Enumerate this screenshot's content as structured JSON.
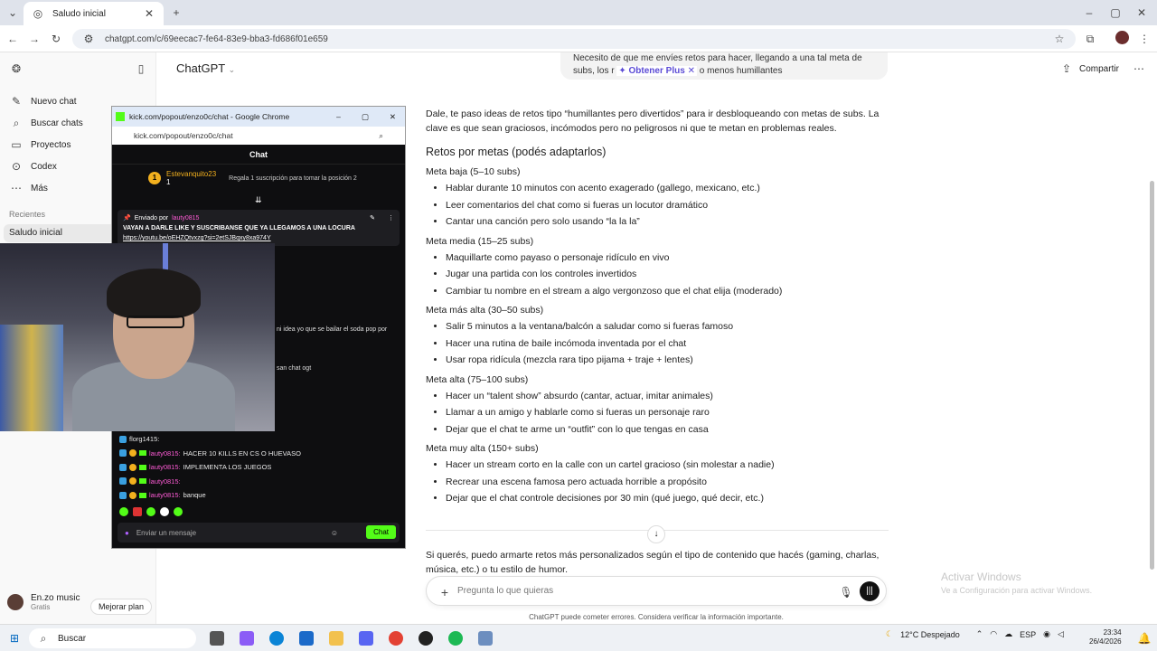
{
  "browser": {
    "tab_title": "Saludo inicial",
    "url": "chatgpt.com/c/69eecac7-fe64-83e9-bba3-fd686f01e659"
  },
  "sidebar": {
    "items": [
      {
        "label": "Nuevo chat"
      },
      {
        "label": "Buscar chats"
      },
      {
        "label": "Proyectos"
      },
      {
        "label": "Codex"
      },
      {
        "label": "Más"
      }
    ],
    "recent_title": "Recientes",
    "recent_active": "Saludo inicial",
    "user_name": "En.zo music",
    "user_plan": "Gratis",
    "upgrade_label": "Mejorar plan"
  },
  "header": {
    "title": "ChatGPT",
    "share": "Compartir"
  },
  "user_message": {
    "line1": "Necesito de que me envíes retos para hacer, llegando a una tal meta de",
    "line2_a": "subs, los r",
    "upsell": "Obtener Plus",
    "line2_b": "o menos humillantes"
  },
  "answer": {
    "intro": "Dale, te paso ideas de retos tipo “humillantes pero divertidos” para ir desbloqueando con metas de subs. La clave es que sean graciosos, incómodos pero no peligrosos ni que te metan en problemas reales.",
    "heading": "Retos por metas (podés adaptarlos)",
    "sections": [
      {
        "title": "Meta baja (5–10 subs)",
        "items": [
          "Hablar durante 10 minutos con acento exagerado (gallego, mexicano, etc.)",
          "Leer comentarios del chat como si fueras un locutor dramático",
          "Cantar una canción pero solo usando “la la la”"
        ]
      },
      {
        "title": "Meta media (15–25 subs)",
        "items": [
          "Maquillarte como payaso o personaje ridículo en vivo",
          "Jugar una partida con los controles invertidos",
          "Cambiar tu nombre en el stream a algo vergonzoso que el chat elija (moderado)"
        ]
      },
      {
        "title": "Meta más alta (30–50 subs)",
        "items": [
          "Salir 5 minutos a la ventana/balcón a saludar como si fueras famoso",
          "Hacer una rutina de baile incómoda inventada por el chat",
          "Usar ropa ridícula (mezcla rara tipo pijama + traje + lentes)"
        ]
      },
      {
        "title": "Meta alta (75–100 subs)",
        "items": [
          "Hacer un “talent show” absurdo (cantar, actuar, imitar animales)",
          "Llamar a un amigo y hablarle como si fueras un personaje raro",
          "Dejar que el chat te arme un “outfit” con lo que tengas en casa"
        ]
      },
      {
        "title": "Meta muy alta (150+ subs)",
        "items": [
          "Hacer un stream corto en la calle con un cartel gracioso (sin molestar a nadie)",
          "Recrear una escena famosa pero actuada horrible a propósito",
          "Dejar que el chat controle decisiones por 30 min (qué juego, qué decir, etc.)"
        ]
      }
    ],
    "followup": "Si querés, puedo armarte retos más personalizados según el tipo de contenido que hacés (gaming, charlas, música, etc.) o tu estilo de humor."
  },
  "composer": {
    "placeholder": "Pregunta lo que quieras",
    "disclaimer": "ChatGPT puede cometer errores. Considera verificar la información importante."
  },
  "windows_activation": {
    "title": "Activar Windows",
    "subtitle": "Ve a Configuración para activar Windows."
  },
  "popout": {
    "window_title": "kick.com/popout/enzo0c/chat - Google Chrome",
    "url": "kick.com/popout/enzo0c/chat",
    "chat_title": "Chat",
    "sub_user": "Estevanquito23",
    "sub_count": "1",
    "rank": "1",
    "sub_text": "Regala 1 suscripción para tomar la posición 2",
    "pinned_by": "Enviado por",
    "pinned_user": "lauty0815",
    "pinned_msg": "VAYAN A DARLE LIKE Y SUSCRIBANSE QUE YA LLEGAMOS A UNA LOCURA",
    "pinned_link": "https://youtu.be/oEHZQtvxzg?si=2etSJBqxy8xa974Y",
    "partial1": "ni idea yo que se bailar el soda pop por",
    "partial2": "san chat ogt",
    "messages": [
      {
        "user": "florg1415:",
        "text": ""
      },
      {
        "user": "lauty0815:",
        "text": "HACER 10 KILLS EN CS O HUEVASO"
      },
      {
        "user": "lauty0815:",
        "text": "IMPLEMENTA LOS JUEGOS"
      },
      {
        "user": "lauty0815:",
        "text": ""
      },
      {
        "user": "lauty0815:",
        "text": "banque"
      }
    ],
    "input_placeholder": "Enviar un mensaje",
    "send_label": "Chat"
  },
  "taskbar": {
    "search": "Buscar",
    "weather": "12°C Despejado",
    "lang": "ESP",
    "time": "23:34",
    "date": "26/4/2026"
  }
}
